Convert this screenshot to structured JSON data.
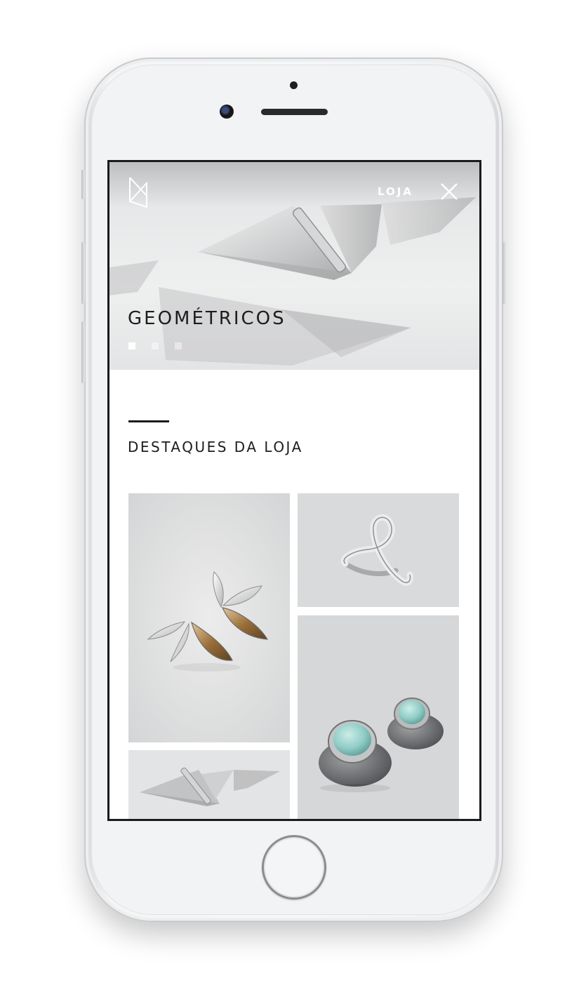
{
  "nav": {
    "shop_label": "LOJA",
    "logo_icon": "monogram-logo-icon",
    "close_icon": "close-icon"
  },
  "hero": {
    "title": "GEOMÉTRICOS",
    "slide_count": 3,
    "active_slide": 1
  },
  "section": {
    "title": "DESTAQUES DA LOJA"
  },
  "products": [
    {
      "image": "leaf-earrings"
    },
    {
      "image": "silver-ring"
    },
    {
      "image": "aquamarine-stud-earrings"
    },
    {
      "image": "geometric-triangle-earrings"
    }
  ]
}
